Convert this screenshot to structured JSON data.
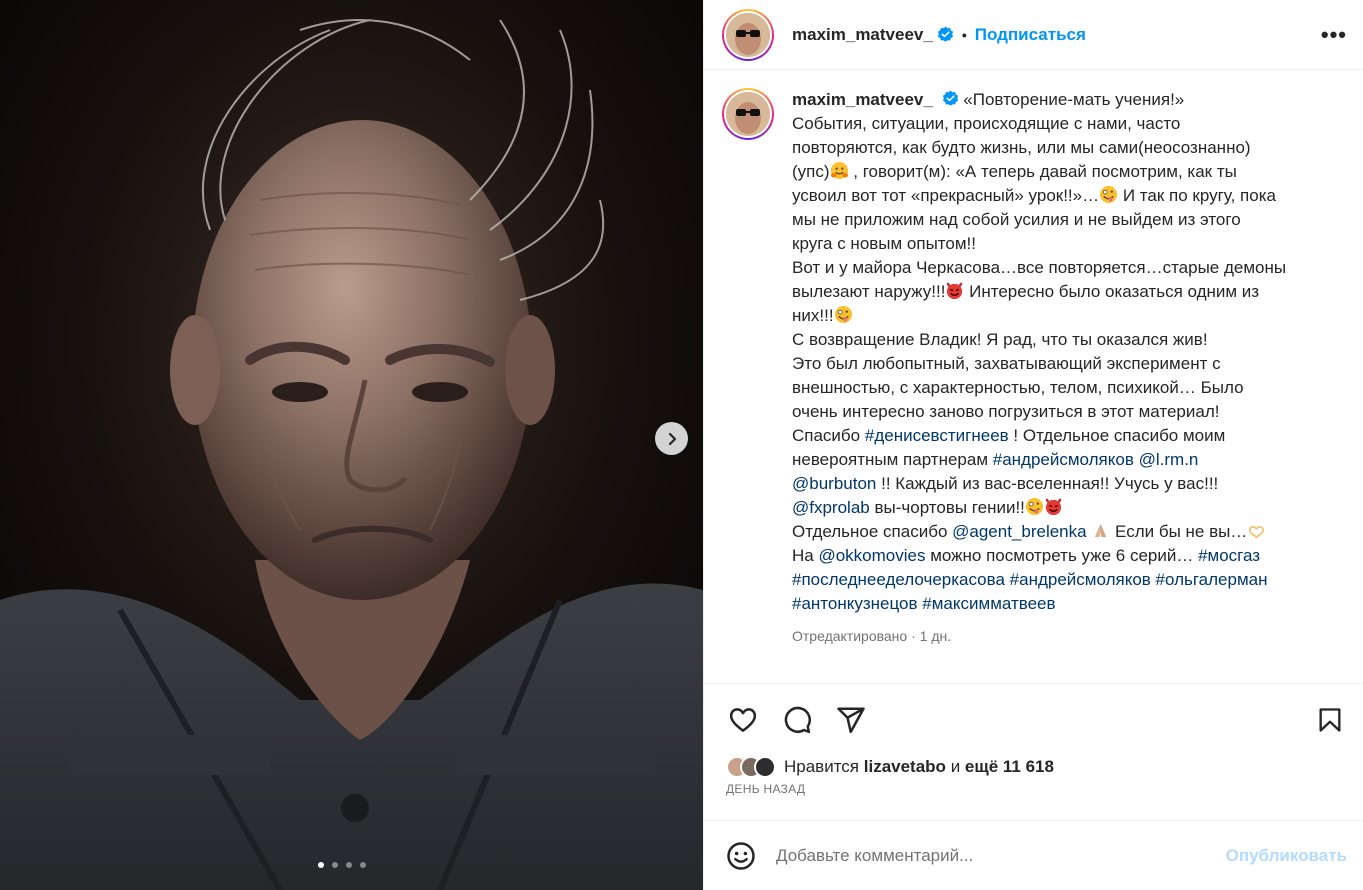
{
  "post": {
    "username": "maxim_matveev_",
    "follow_label": "Подписаться",
    "separator": "•",
    "more_label": "•••"
  },
  "caption": {
    "l1": "«Повторение-мать учения!»",
    "l2": "События, ситуации, происходящие с нами, часто",
    "l3": "повторяются, как будто жизнь, или мы сами(неосознанно)",
    "l4a": "(упс)",
    "l4b": " , говорит(м): «А теперь давай посмотрим, как ты",
    "l5a": "усвоил вот тот «прекрасный» урок!!»…",
    "l5b": " И так по кругу, пока",
    "l6": "мы не приложим над собой усилия и не выйдем из этого",
    "l7": "круга с новым опытом!!",
    "l8": "Вот и у майора Черкасова…все повторяется…старые демоны",
    "l9a": "вылезают наружу!!!",
    "l9b": " Интересно было оказаться одним из",
    "l10": "них!!!",
    "l11": "С возвращение Владик! Я рад, что ты оказался жив!",
    "l12": "Это был любопытный, захватывающий эксперимент с",
    "l13": "внешностью, с характерностью, телом, психикой… Было",
    "l14": "очень интересно заново погрузиться в этот материал!",
    "l15a": "Спасибо ",
    "tag1": "#денисевстигнеев",
    "l15b": " ! Отдельное спасибо моим",
    "l16a": "невероятным партнерам ",
    "tag2": "#андрейсмоляков",
    "m1": "@l.rm.n",
    "m2": "@burbuton",
    "l17b": " !! Каждый из вас-вселенная!! Учусь у вас!!!",
    "m3": "@fxprolab",
    "l18b": " вы-чортовы гении!!",
    "l19a": "Отдельное спасибо ",
    "m4": "@agent_brelenka",
    "l19b": " Если бы не вы…",
    "l20a": "На ",
    "m5": "@okkomovies",
    "l20b": " можно посмотреть уже 6 серий… ",
    "tag3": "#мосгаз",
    "tag4": "#последнееделочеркасова",
    "tag5": "#андрейсмоляков",
    "tag6": "#ольгалерман",
    "tag7": "#антонкузнецов",
    "tag8": "#максимматвеев",
    "edited": "Отредактировано",
    "edited_sep": " · ",
    "age": "1 дн."
  },
  "likes": {
    "prefix": "Нравится",
    "user": "lizavetabo",
    "conj": "и",
    "count": "ещё 11 618",
    "date": "ДЕНЬ НАЗАД"
  },
  "comment": {
    "placeholder": "Добавьте комментарий...",
    "publish_label": "Опубликовать"
  },
  "carousel": {
    "total": 4,
    "active": 1
  },
  "icons": [
    "verified-icon",
    "heart-icon",
    "comment-icon",
    "share-icon",
    "bookmark-icon",
    "emoji-icon",
    "chevron-right-icon"
  ],
  "colors": {
    "link": "#0095f6",
    "hashtag": "#00376b",
    "muted": "#737373",
    "publish_disabled": "#b3dbff"
  }
}
